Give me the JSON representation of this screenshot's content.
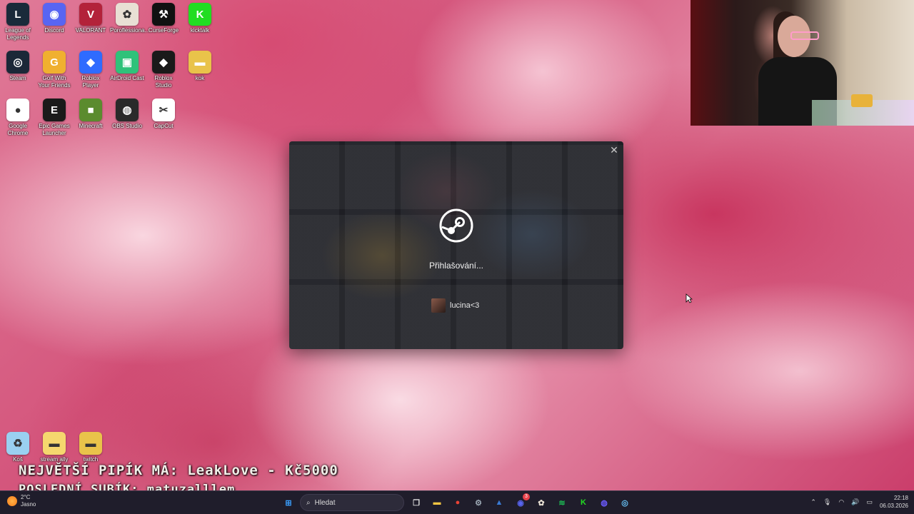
{
  "desktop": {
    "icons": [
      {
        "label": "League of Legends",
        "icon": "league-of-legends-icon",
        "color": "#1a2a3a",
        "glyph": "L"
      },
      {
        "label": "Discord",
        "icon": "discord-icon",
        "color": "#5865f2",
        "glyph": "◉"
      },
      {
        "label": "VALORANT",
        "icon": "valorant-icon",
        "color": "#b3223a",
        "glyph": "V"
      },
      {
        "label": "Poroflessiona...",
        "icon": "poro-icon",
        "color": "#e8e0d4",
        "glyph": "✿"
      },
      {
        "label": "CurseForge",
        "icon": "curseforge-icon",
        "color": "#111111",
        "glyph": "⚒"
      },
      {
        "label": "kicktalk",
        "icon": "kicktalk-icon",
        "color": "#22dd22",
        "glyph": "K"
      },
      {
        "label": "Steam",
        "icon": "steam-icon",
        "color": "#1b2838",
        "glyph": "◎"
      },
      {
        "label": "Golf With Your Friends",
        "icon": "golf-icon",
        "color": "#f0b030",
        "glyph": "G"
      },
      {
        "label": "Roblox Player",
        "icon": "roblox-player-icon",
        "color": "#2f6bff",
        "glyph": "◆"
      },
      {
        "label": "AirDroid Cast",
        "icon": "airdroid-icon",
        "color": "#2fc27a",
        "glyph": "▣"
      },
      {
        "label": "Roblox Studio",
        "icon": "roblox-studio-icon",
        "color": "#1a1a1a",
        "glyph": "◆"
      },
      {
        "label": "kok",
        "icon": "folder-icon",
        "color": "#e9c34a",
        "glyph": "▬"
      },
      {
        "label": "Google Chrome",
        "icon": "chrome-icon",
        "color": "#ffffff",
        "glyph": "●"
      },
      {
        "label": "Epic Games Launcher",
        "icon": "epic-games-icon",
        "color": "#1a1a1a",
        "glyph": "E"
      },
      {
        "label": "Minecraft",
        "icon": "minecraft-icon",
        "color": "#5b8b2e",
        "glyph": "■"
      },
      {
        "label": "OBS Studio",
        "icon": "obs-icon",
        "color": "#2a2a2a",
        "glyph": "◍"
      },
      {
        "label": "CapCut",
        "icon": "capcut-icon",
        "color": "#ffffff",
        "glyph": "✂"
      }
    ],
    "bottom_icons": [
      {
        "label": "Koš",
        "icon": "recycle-bin-icon",
        "color": "#9ad0f0",
        "glyph": "♻"
      },
      {
        "label": "stream ally",
        "icon": "folder-icon",
        "color": "#f5d76e",
        "glyph": "▬"
      },
      {
        "label": "twitch",
        "icon": "folder-icon",
        "color": "#e9c34a",
        "glyph": "▬"
      }
    ]
  },
  "steam_dialog": {
    "status": "Přihlašování...",
    "username": "lucina<3",
    "close_glyph": "✕"
  },
  "overlay": {
    "line1": "NEJVĚTŠÍ PIPÍK MÁ: LeakLove - Kč5000",
    "line2": "POSLEDNÍ SUBÍK: matuzalllem"
  },
  "taskbar": {
    "weather_temp": "2°C",
    "weather_desc": "Jasno",
    "search_placeholder": "Hledat",
    "notification_badge": "3",
    "time": "22:18",
    "date": "06.03.2026",
    "apps": [
      {
        "icon": "windows-start-icon",
        "color": "#3aa0ff",
        "glyph": "⊞"
      },
      {
        "icon": "task-view-icon",
        "color": "#dddddd",
        "glyph": "❐"
      },
      {
        "icon": "file-explorer-icon",
        "color": "#f5c542",
        "glyph": "▬"
      },
      {
        "icon": "chrome-icon",
        "color": "#ea4335",
        "glyph": "●"
      },
      {
        "icon": "settings-icon",
        "color": "#9aa6b2",
        "glyph": "⚙"
      },
      {
        "icon": "photos-icon",
        "color": "#3a7bd5",
        "glyph": "▲"
      },
      {
        "icon": "discord-icon",
        "color": "#5865f2",
        "glyph": "◉"
      },
      {
        "icon": "poro-icon",
        "color": "#e8e0d4",
        "glyph": "✿"
      },
      {
        "icon": "spotify-icon",
        "color": "#1db954",
        "glyph": "≋"
      },
      {
        "icon": "kick-icon",
        "color": "#22dd22",
        "glyph": "K"
      },
      {
        "icon": "obs-icon",
        "color": "#6b5bff",
        "glyph": "◍"
      },
      {
        "icon": "steam-icon",
        "color": "#66c0f4",
        "glyph": "◎"
      }
    ]
  }
}
